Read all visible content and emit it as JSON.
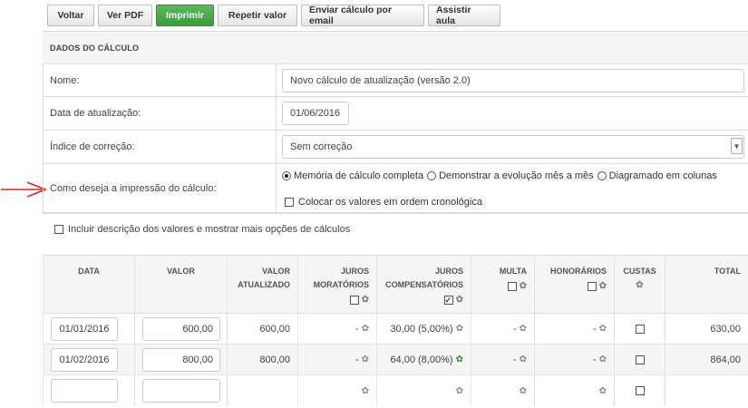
{
  "toolbar": {
    "back_label": "Voltar",
    "view_pdf_label": "Ver PDF",
    "print_label": "Imprimir",
    "repeat_value_label": "Repetir valor",
    "send_email_label": "Enviar cálculo por email",
    "watch_class_label": "Assistir aula",
    "primary_color": "#4cae4c"
  },
  "calc_data": {
    "section_title": "DADOS DO CÁLCULO",
    "name_label": "Nome:",
    "name_value": "Novo cálculo de atualização (versão 2.0)",
    "update_date_label": "Data de atualização:",
    "update_date_value": "01/06/2016",
    "index_label": "Índice de correção:",
    "index_value": "Sem correção",
    "print_mode_label": "Como deseja a impressão do cálculo:",
    "print_options": [
      {
        "label": "Memória de cálculo completa",
        "selected": true
      },
      {
        "label": "Demonstrar a evolução mês a mês",
        "selected": false
      },
      {
        "label": "Diagramado em colunas",
        "selected": false
      }
    ],
    "chronological_label": "Colocar os valores em ordem cronológica",
    "chronological_checked": false,
    "include_description_label": "Incluir descrição dos valores e mostrar mais opções de cálculos",
    "include_description_checked": false,
    "arrow_color": "#d9261c"
  },
  "table": {
    "headers": {
      "date": "DATA",
      "value": "VALOR",
      "updated_value_1": "VALOR",
      "updated_value_2": "ATUALIZADO",
      "moratory_1": "JUROS",
      "moratory_2": "MORATÓRIOS",
      "compensatory_1": "JUROS",
      "compensatory_2": "COMPENSATÓRIOS",
      "fine": "MULTA",
      "fees": "HONORÁRIOS",
      "costs": "CUSTAS",
      "total": "TOTAL"
    },
    "moratory_checked": false,
    "compensatory_checked": true,
    "fine_checked": false,
    "fees_checked": false,
    "rows": [
      {
        "date": "01/01/2016",
        "value": "600,00",
        "updated": "600,00",
        "moratory": "-",
        "compensatory": "30,00 (5,00%)",
        "fine": "-",
        "fees": "-",
        "total": "630,00"
      },
      {
        "date": "01/02/2016",
        "value": "800,00",
        "updated": "800,00",
        "moratory": "-",
        "compensatory": "64,00 (8,00%)",
        "fine": "-",
        "fees": "-",
        "total": "864,00"
      }
    ]
  }
}
